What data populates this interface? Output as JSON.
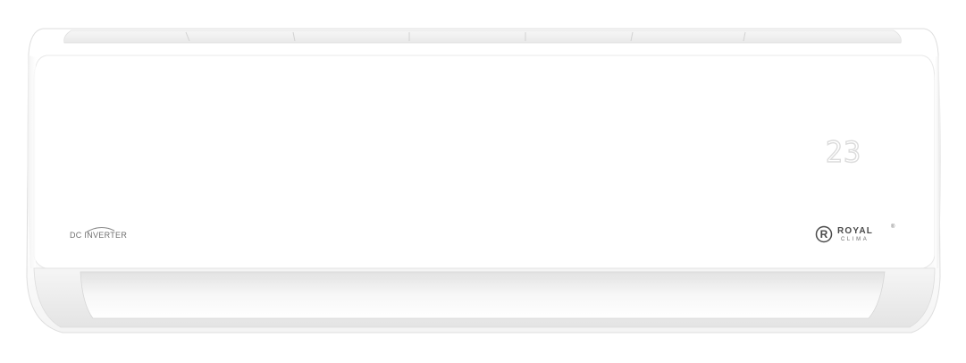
{
  "product": {
    "badge_text": "DC INVERTER",
    "brand_letter": "R",
    "brand_name": "ROYAL",
    "brand_sub": "CLIMA",
    "brand_registered": "®",
    "display_temperature": "23"
  },
  "colors": {
    "body": "#ffffff",
    "shadow": "#e3e3e3",
    "logo_text": "#4a4a4a",
    "display_segments": "#dcdcdc"
  }
}
